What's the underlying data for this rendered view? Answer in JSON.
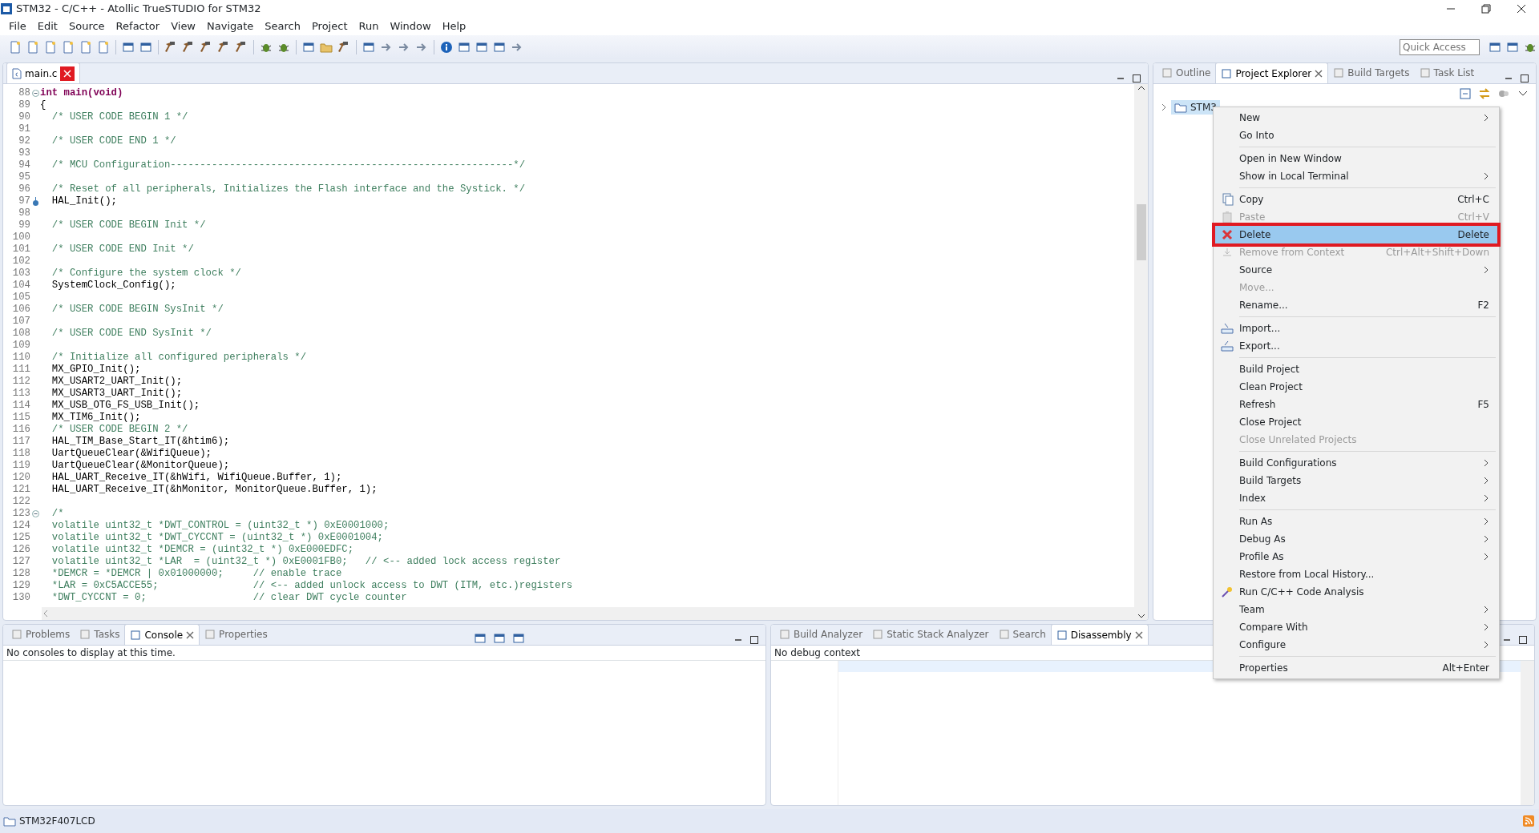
{
  "window": {
    "title": "STM32 - C/C++ - Atollic TrueSTUDIO for STM32"
  },
  "menu_bar": [
    "File",
    "Edit",
    "Source",
    "Refactor",
    "View",
    "Navigate",
    "Search",
    "Project",
    "Run",
    "Window",
    "Help"
  ],
  "quick_access": {
    "placeholder": "Quick Access"
  },
  "editor": {
    "tabs": [
      {
        "label": "main.c",
        "selected": true,
        "close_outlined": true
      }
    ],
    "lines": [
      {
        "number": "88",
        "text": "int main(void)",
        "kind": "signature",
        "collapsible": true,
        "marked": false
      },
      {
        "number": "89",
        "text": "{",
        "kind": "code",
        "collapsible": false,
        "marked": false
      },
      {
        "number": "90",
        "text": "  /* USER CODE BEGIN 1 */",
        "kind": "comment",
        "collapsible": false,
        "marked": false
      },
      {
        "number": "91",
        "collapsible": false,
        "marked": false
      },
      {
        "number": "92",
        "text": "  /* USER CODE END 1 */",
        "kind": "comment",
        "collapsible": false,
        "marked": false
      },
      {
        "number": "93",
        "collapsible": false,
        "marked": false
      },
      {
        "number": "94",
        "text": "  /* MCU Configuration----------------------------------------------------------*/",
        "kind": "comment",
        "collapsible": false,
        "marked": false
      },
      {
        "number": "95",
        "collapsible": false,
        "marked": false
      },
      {
        "number": "96",
        "text": "  /* Reset of all peripherals, Initializes the Flash interface and the Systick. */",
        "kind": "comment",
        "collapsible": false,
        "marked": false
      },
      {
        "number": "97",
        "text": "  HAL_Init();",
        "kind": "code",
        "collapsible": false,
        "marked": true
      },
      {
        "number": "98",
        "collapsible": false,
        "marked": false
      },
      {
        "number": "99",
        "text": "  /* USER CODE BEGIN Init */",
        "kind": "comment",
        "collapsible": false,
        "marked": false
      },
      {
        "number": "100",
        "collapsible": false,
        "marked": false
      },
      {
        "number": "101",
        "text": "  /* USER CODE END Init */",
        "kind": "comment",
        "collapsible": false,
        "marked": false
      },
      {
        "number": "102",
        "collapsible": false,
        "marked": false
      },
      {
        "number": "103",
        "text": "  /* Configure the system clock */",
        "kind": "comment",
        "collapsible": false,
        "marked": false
      },
      {
        "number": "104",
        "text": "  SystemClock_Config();",
        "kind": "code",
        "collapsible": false,
        "marked": false
      },
      {
        "number": "105",
        "collapsible": false,
        "marked": false
      },
      {
        "number": "106",
        "text": "  /* USER CODE BEGIN SysInit */",
        "kind": "comment",
        "collapsible": false,
        "marked": false
      },
      {
        "number": "107",
        "collapsible": false,
        "marked": false
      },
      {
        "number": "108",
        "text": "  /* USER CODE END SysInit */",
        "kind": "comment",
        "collapsible": false,
        "marked": false
      },
      {
        "number": "109",
        "collapsible": false,
        "marked": false
      },
      {
        "number": "110",
        "text": "  /* Initialize all configured peripherals */",
        "kind": "comment",
        "collapsible": false,
        "marked": false
      },
      {
        "number": "111",
        "text": "  MX_GPIO_Init();",
        "kind": "code",
        "collapsible": false,
        "marked": false
      },
      {
        "number": "112",
        "text": "  MX_USART2_UART_Init();",
        "kind": "code",
        "collapsible": false,
        "marked": false
      },
      {
        "number": "113",
        "text": "  MX_USART3_UART_Init();",
        "kind": "code",
        "collapsible": false,
        "marked": false
      },
      {
        "number": "114",
        "text": "  MX_USB_OTG_FS_USB_Init();",
        "kind": "code",
        "collapsible": false,
        "marked": false
      },
      {
        "number": "115",
        "text": "  MX_TIM6_Init();",
        "kind": "code",
        "collapsible": false,
        "marked": false
      },
      {
        "number": "116",
        "text": "  /* USER CODE BEGIN 2 */",
        "kind": "comment",
        "collapsible": false,
        "marked": false
      },
      {
        "number": "117",
        "text": "  HAL_TIM_Base_Start_IT(&htim6);",
        "kind": "code",
        "collapsible": false,
        "marked": false
      },
      {
        "number": "118",
        "text": "  UartQueueClear(&WifiQueue);",
        "kind": "code",
        "collapsible": false,
        "marked": false
      },
      {
        "number": "119",
        "text": "  UartQueueClear(&MonitorQueue);",
        "kind": "code",
        "collapsible": false,
        "marked": false
      },
      {
        "number": "120",
        "text": "  HAL_UART_Receive_IT(&hWifi, WifiQueue.Buffer, 1);",
        "kind": "code",
        "collapsible": false,
        "marked": false
      },
      {
        "number": "121",
        "text": "  HAL_UART_Receive_IT(&hMonitor, MonitorQueue.Buffer, 1);",
        "kind": "code",
        "collapsible": false,
        "marked": false
      },
      {
        "number": "122",
        "collapsible": false,
        "marked": false
      },
      {
        "number": "123",
        "text": "  /*",
        "kind": "comment",
        "collapsible": true,
        "marked": false
      },
      {
        "number": "124",
        "text": "  volatile uint32_t *DWT_CONTROL = (uint32_t *) 0xE0001000;",
        "kind": "comment",
        "collapsible": false,
        "marked": false
      },
      {
        "number": "125",
        "text": "  volatile uint32_t *DWT_CYCCNT = (uint32_t *) 0xE0001004;",
        "kind": "comment",
        "collapsible": false,
        "marked": false
      },
      {
        "number": "126",
        "text": "  volatile uint32_t *DEMCR = (uint32_t *) 0xE000EDFC;",
        "kind": "comment",
        "collapsible": false,
        "marked": false
      },
      {
        "number": "127",
        "text": "  volatile uint32_t *LAR  = (uint32_t *) 0xE0001FB0;   // <-- added lock access register",
        "kind": "comment",
        "collapsible": false,
        "marked": false
      },
      {
        "number": "128",
        "text": "  *DEMCR = *DEMCR | 0x01000000;     // enable trace",
        "kind": "comment",
        "collapsible": false,
        "marked": false
      },
      {
        "number": "129",
        "text": "  *LAR = 0xC5ACCE55;                // <-- added unlock access to DWT (ITM, etc.)registers",
        "kind": "comment",
        "collapsible": false,
        "marked": false
      },
      {
        "number": "130",
        "text": "  *DWT_CYCCNT = 0;                  // clear DWT cycle counter",
        "kind": "comment",
        "collapsible": false,
        "marked": false
      }
    ]
  },
  "right_panel": {
    "tabs": [
      {
        "label": "Outline",
        "selected": false,
        "closable": false
      },
      {
        "label": "Project Explorer",
        "selected": true,
        "closable": true
      },
      {
        "label": "Build Targets",
        "selected": false,
        "closable": false
      },
      {
        "label": "Task List",
        "selected": false,
        "closable": false
      }
    ],
    "tree": [
      {
        "label": "STM3",
        "expanded": false,
        "selected": true
      }
    ]
  },
  "context_menu": [
    {
      "kind": "item",
      "label": "New",
      "submenu": true,
      "disabled": false,
      "selected": false,
      "outlined": false
    },
    {
      "kind": "item",
      "label": "Go Into",
      "submenu": false,
      "disabled": false,
      "selected": false,
      "outlined": false
    },
    {
      "kind": "separator"
    },
    {
      "kind": "item",
      "label": "Open in New Window",
      "submenu": false,
      "disabled": false,
      "selected": false,
      "outlined": false
    },
    {
      "kind": "item",
      "label": "Show in Local Terminal",
      "submenu": true,
      "disabled": false,
      "selected": false,
      "outlined": false
    },
    {
      "kind": "separator"
    },
    {
      "kind": "item",
      "label": "Copy",
      "shortcut": "Ctrl+C",
      "submenu": false,
      "disabled": false,
      "selected": false,
      "outlined": false
    },
    {
      "kind": "item",
      "label": "Paste",
      "shortcut": "Ctrl+V",
      "submenu": false,
      "disabled": true,
      "selected": false,
      "outlined": false
    },
    {
      "kind": "item",
      "label": "Delete",
      "shortcut": "Delete",
      "submenu": false,
      "disabled": false,
      "selected": true,
      "outlined": true
    },
    {
      "kind": "item",
      "label": "Remove from Context",
      "shortcut": "Ctrl+Alt+Shift+Down",
      "submenu": false,
      "disabled": true,
      "selected": false,
      "outlined": false
    },
    {
      "kind": "item",
      "label": "Source",
      "submenu": true,
      "disabled": false,
      "selected": false,
      "outlined": false
    },
    {
      "kind": "item",
      "label": "Move...",
      "submenu": false,
      "disabled": true,
      "selected": false,
      "outlined": false
    },
    {
      "kind": "item",
      "label": "Rename...",
      "shortcut": "F2",
      "submenu": false,
      "disabled": false,
      "selected": false,
      "outlined": false
    },
    {
      "kind": "separator"
    },
    {
      "kind": "item",
      "label": "Import...",
      "submenu": false,
      "disabled": false,
      "selected": false,
      "outlined": false
    },
    {
      "kind": "item",
      "label": "Export...",
      "submenu": false,
      "disabled": false,
      "selected": false,
      "outlined": false
    },
    {
      "kind": "separator"
    },
    {
      "kind": "item",
      "label": "Build Project",
      "submenu": false,
      "disabled": false,
      "selected": false,
      "outlined": false
    },
    {
      "kind": "item",
      "label": "Clean Project",
      "submenu": false,
      "disabled": false,
      "selected": false,
      "outlined": false
    },
    {
      "kind": "item",
      "label": "Refresh",
      "shortcut": "F5",
      "submenu": false,
      "disabled": false,
      "selected": false,
      "outlined": false
    },
    {
      "kind": "item",
      "label": "Close Project",
      "submenu": false,
      "disabled": false,
      "selected": false,
      "outlined": false
    },
    {
      "kind": "item",
      "label": "Close Unrelated Projects",
      "submenu": false,
      "disabled": true,
      "selected": false,
      "outlined": false
    },
    {
      "kind": "separator"
    },
    {
      "kind": "item",
      "label": "Build Configurations",
      "submenu": true,
      "disabled": false,
      "selected": false,
      "outlined": false
    },
    {
      "kind": "item",
      "label": "Build Targets",
      "submenu": true,
      "disabled": false,
      "selected": false,
      "outlined": false
    },
    {
      "kind": "item",
      "label": "Index",
      "submenu": true,
      "disabled": false,
      "selected": false,
      "outlined": false
    },
    {
      "kind": "separator"
    },
    {
      "kind": "item",
      "label": "Run As",
      "submenu": true,
      "disabled": false,
      "selected": false,
      "outlined": false
    },
    {
      "kind": "item",
      "label": "Debug As",
      "submenu": true,
      "disabled": false,
      "selected": false,
      "outlined": false
    },
    {
      "kind": "item",
      "label": "Profile As",
      "submenu": true,
      "disabled": false,
      "selected": false,
      "outlined": false
    },
    {
      "kind": "item",
      "label": "Restore from Local History...",
      "submenu": false,
      "disabled": false,
      "selected": false,
      "outlined": false
    },
    {
      "kind": "item",
      "label": "Run C/C++ Code Analysis",
      "submenu": false,
      "disabled": false,
      "selected": false,
      "outlined": false
    },
    {
      "kind": "item",
      "label": "Team",
      "submenu": true,
      "disabled": false,
      "selected": false,
      "outlined": false
    },
    {
      "kind": "item",
      "label": "Compare With",
      "submenu": true,
      "disabled": false,
      "selected": false,
      "outlined": false
    },
    {
      "kind": "item",
      "label": "Configure",
      "submenu": true,
      "disabled": false,
      "selected": false,
      "outlined": false
    },
    {
      "kind": "separator"
    },
    {
      "kind": "item",
      "label": "Properties",
      "shortcut": "Alt+Enter",
      "submenu": false,
      "disabled": false,
      "selected": false,
      "outlined": false
    }
  ],
  "console_panel": {
    "tabs": [
      {
        "label": "Problems",
        "selected": false,
        "closable": false
      },
      {
        "label": "Tasks",
        "selected": false,
        "closable": false
      },
      {
        "label": "Console",
        "selected": true,
        "closable": true
      },
      {
        "label": "Properties",
        "selected": false,
        "closable": false
      }
    ],
    "message": "No consoles to display at this time."
  },
  "disassembly_panel": {
    "tabs": [
      {
        "label": "Build Analyzer",
        "selected": false,
        "closable": false
      },
      {
        "label": "Static Stack Analyzer",
        "selected": false,
        "closable": false
      },
      {
        "label": "Search",
        "selected": false,
        "closable": false
      },
      {
        "label": "Disassembly",
        "selected": true,
        "closable": true
      }
    ],
    "message": "No debug context"
  },
  "status_bar": {
    "project": "STM32F407LCD"
  }
}
